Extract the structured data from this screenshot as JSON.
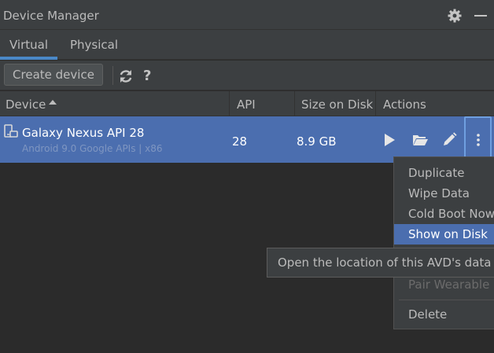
{
  "window": {
    "title": "Device Manager"
  },
  "title_icons": [
    "gear-icon",
    "minimize-icon"
  ],
  "tabs": [
    {
      "label": "Virtual",
      "selected": true
    },
    {
      "label": "Physical",
      "selected": false
    }
  ],
  "toolbar": {
    "create_label": "Create device",
    "help_label": "?"
  },
  "table": {
    "headers": [
      "Device",
      "API",
      "Size on Disk",
      "Actions"
    ],
    "sort": {
      "column": "Device",
      "direction": "ascending"
    },
    "rows": [
      {
        "name": "Galaxy Nexus API 28",
        "subtitle": "Android 9.0 Google APIs | x86",
        "api": "28",
        "size": "8.9 GB",
        "selected": true,
        "actions": [
          "play-icon",
          "folder-open-icon",
          "pencil-icon",
          "more-vertical-icon"
        ]
      }
    ]
  },
  "menu": {
    "items": [
      "Duplicate",
      "Wipe Data",
      "Cold Boot Now",
      "Show on Disk",
      "Pair Wearable",
      "Delete"
    ],
    "highlighted": "Show on Disk",
    "disabled": [
      "Pair Wearable"
    ]
  },
  "tooltip": {
    "text": "Open the location of this AVD's data file"
  },
  "colors": {
    "background": "#2b2b2b",
    "panel": "#3c3f41",
    "selection": "#4b6eaf",
    "accent": "#4a88c7",
    "text": "#bbbbbb"
  }
}
